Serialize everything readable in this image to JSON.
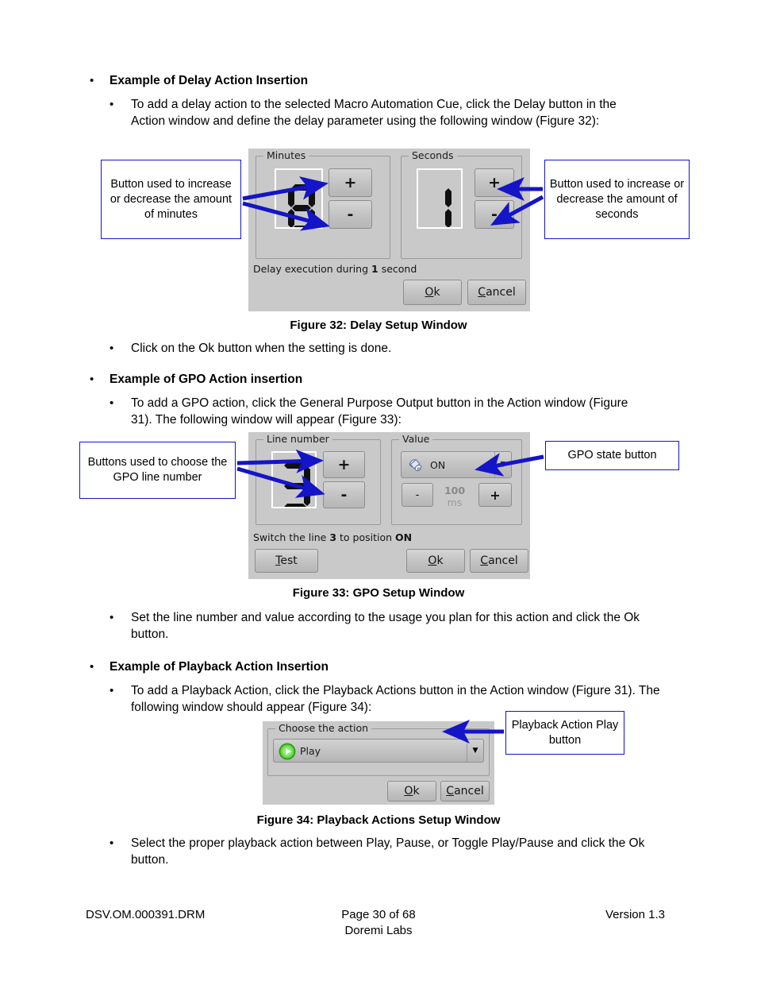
{
  "document": {
    "page_label": "Page 30 of 68",
    "company": "Doremi Labs",
    "doc_number": "DSV.OM.000391.DRM",
    "version": "Version 1.3"
  },
  "sections": {
    "delay": {
      "heading": "Example of Delay Action Insertion",
      "body": "To add a delay action to the selected Macro Automation Cue, click the Delay button in the Action window and define the delay parameter using the following window (Figure 32):",
      "after_note": "Click on the Ok button when the setting is done.",
      "caption": "Figure 32: Delay Setup Window",
      "callout_left": "Button used to increase or decrease the amount of minutes",
      "callout_right": "Button used to increase or decrease the amount of seconds"
    },
    "gpo": {
      "heading": "Example of GPO Action insertion",
      "body": "To add a GPO action, click the General Purpose Output button in the Action window (Figure 31). The following window will appear (Figure 33):",
      "after_note": "Set the line number and value according to the usage you plan for this action and click the Ok button.",
      "caption": "Figure 33: GPO Setup Window",
      "callout_left": "Buttons used to choose the GPO line number",
      "callout_right": "GPO state button"
    },
    "playback": {
      "heading": "Example of Playback Action Insertion",
      "body": "To add a Playback Action, click the Playback Actions button in the Action window (Figure 31). The following window should appear (Figure 34):",
      "after_note": "Select the proper playback action between Play, Pause, or Toggle Play/Pause and click the Ok button.",
      "caption": "Figure 34: Playback Actions Setup Window",
      "callout_right": "Playback Action Play button"
    }
  },
  "delay_dialog": {
    "minutes_group": "Minutes",
    "seconds_group": "Seconds",
    "minutes_value": "0",
    "seconds_value": "1",
    "plus_label": "+",
    "minus_label": "-",
    "status_prefix": "Delay execution during ",
    "status_value": "1",
    "status_suffix": " second",
    "ok_label": "Ok",
    "cancel_label": "Cancel"
  },
  "gpo_dialog": {
    "line_group": "Line number",
    "value_group": "Value",
    "line_value": "3",
    "plus_label": "+",
    "minus_label": "-",
    "state_value": "ON",
    "state_icon": "switch-icon",
    "duration_value": "100",
    "duration_unit": "ms",
    "duration_minus": "-",
    "duration_plus": "+",
    "status_a": "Switch the line ",
    "status_b": "3",
    "status_c": " to position ",
    "status_d": "ON",
    "test_label": "Test",
    "ok_label": "Ok",
    "cancel_label": "Cancel"
  },
  "playback_dialog": {
    "group_title": "Choose the action",
    "action_value": "Play",
    "action_icon": "play-icon",
    "ok_label": "Ok",
    "cancel_label": "Cancel"
  },
  "colors": {
    "callout_border": "#1414c8",
    "arrow": "#1414c8",
    "dialog_bg": "#c9c9c9",
    "play_green": "#3fbf22"
  }
}
